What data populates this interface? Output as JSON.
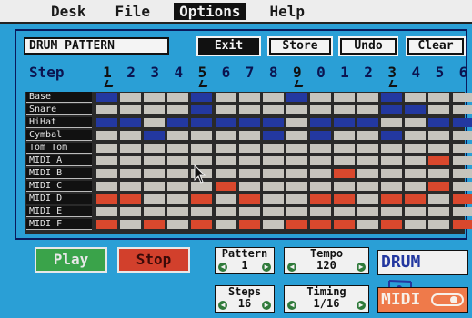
{
  "menu": {
    "items": [
      {
        "label": "Desk",
        "active": false
      },
      {
        "label": "File",
        "active": false
      },
      {
        "label": "Options",
        "active": true
      },
      {
        "label": "Help",
        "active": false
      }
    ]
  },
  "panel": {
    "title": "DRUM PATTERN",
    "buttons": {
      "exit": "Exit",
      "store": "Store",
      "undo": "Undo",
      "clear": "Clear"
    }
  },
  "steps": {
    "label": "Step",
    "numbers": [
      "1",
      "2",
      "3",
      "4",
      "5",
      "6",
      "7",
      "8",
      "9",
      "0",
      "1",
      "2",
      "3",
      "4",
      "5",
      "6"
    ]
  },
  "lanes": [
    {
      "label": "Base",
      "pattern": "B...B...B...B..."
    },
    {
      "label": "Snare",
      "pattern": "....B.......BB.."
    },
    {
      "label": "HiHat",
      "pattern": "BB.BBBBB.BBB..BB"
    },
    {
      "label": "Cymbal",
      "pattern": "..B....B.B..B..."
    },
    {
      "label": "Tom Tom",
      "pattern": "................"
    },
    {
      "label": "MIDI A",
      "pattern": "..............R."
    },
    {
      "label": "MIDI B",
      "pattern": "..........R....."
    },
    {
      "label": "MIDI C",
      "pattern": ".....R........R."
    },
    {
      "label": "MIDI D",
      "pattern": "RR..R.R..RR.RR.R"
    },
    {
      "label": "MIDI E",
      "pattern": "................"
    },
    {
      "label": "MIDI F",
      "pattern": "R.R.R.R.RRR.R..R"
    }
  ],
  "transport": {
    "play": "Play",
    "stop": "Stop"
  },
  "params": {
    "pattern": {
      "name": "Pattern",
      "value": "1"
    },
    "tempo": {
      "name": "Tempo",
      "value": "120"
    },
    "steps": {
      "name": "Steps",
      "value": "16"
    },
    "timing": {
      "name": "Timing",
      "value": "1/16"
    }
  },
  "logos": {
    "drum": "DRUM",
    "midi": "MIDI"
  },
  "colors": {
    "background": "#2a9fd6",
    "active_step": "#2338a0",
    "midi_step": "#d9482d",
    "off_step": "#c6c4bd"
  }
}
